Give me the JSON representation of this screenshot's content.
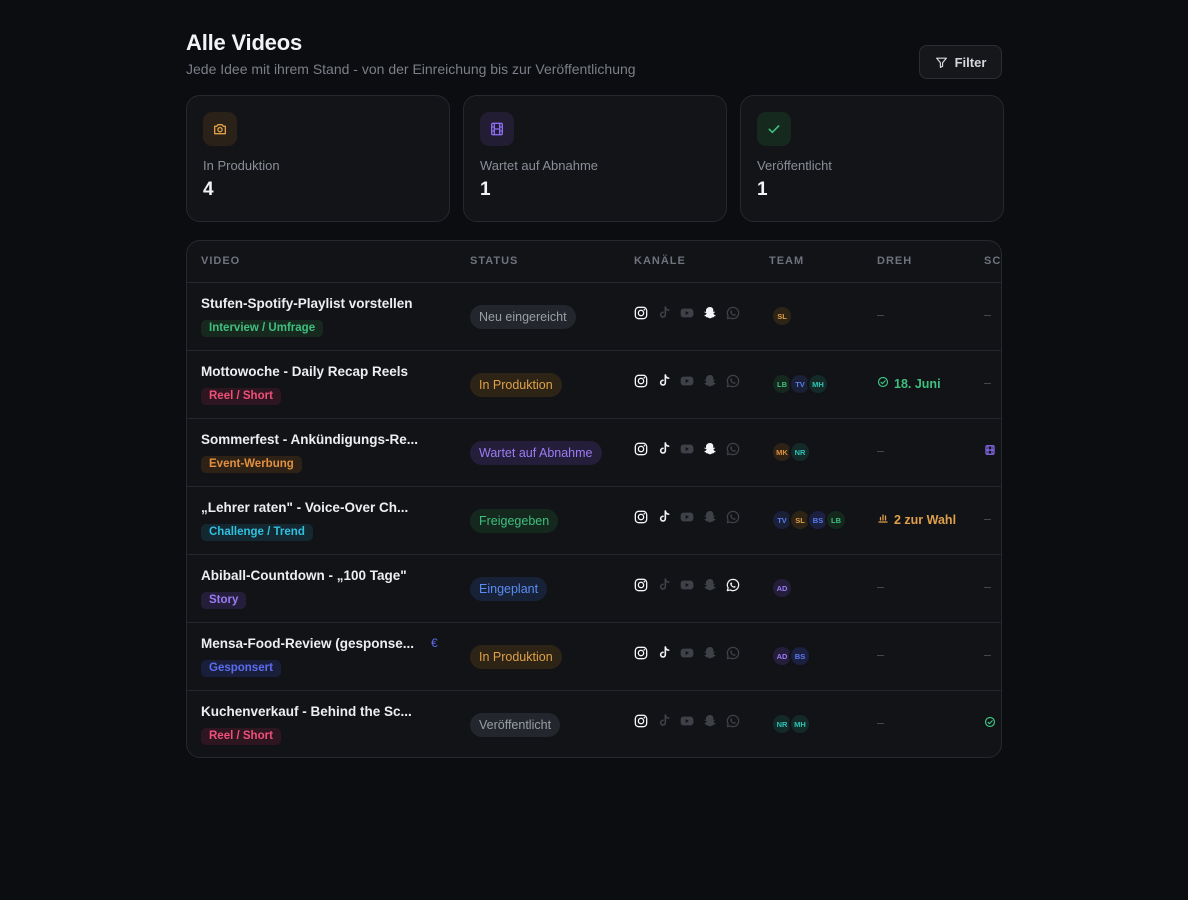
{
  "header": {
    "title": "Alle Videos",
    "subtitle": "Jede Idee mit ihrem Stand - von der Einreichung bis zur Veröffentlichung",
    "filter_label": "Filter"
  },
  "stats": [
    {
      "label": "In Produktion",
      "value": "4",
      "icon": "camera-icon",
      "color": "#e0a04a",
      "bg": "#2a2118"
    },
    {
      "label": "Wartet auf Abnahme",
      "value": "1",
      "icon": "film-icon",
      "color": "#8b6cf0",
      "bg": "#221d33"
    },
    {
      "label": "Veröffentlicht",
      "value": "1",
      "icon": "check-icon",
      "color": "#3fbf7f",
      "bg": "#16291f"
    }
  ],
  "table": {
    "columns": [
      "VIDEO",
      "STATUS",
      "KANÄLE",
      "TEAM",
      "DREH",
      "SC"
    ],
    "rows": [
      {
        "title": "Stufen-Spotify-Playlist vorstellen",
        "tag": "Interview / Umfrage",
        "tag_color": "#3fbf7f",
        "tag_bg": "#17291f",
        "status": "Neu eingereicht",
        "status_color": "#9a9ea6",
        "status_bg": "#23262c",
        "channels": {
          "instagram": true,
          "tiktok": false,
          "youtube": false,
          "snapchat": true,
          "whatsapp": false
        },
        "team": [
          {
            "i": "SL",
            "c": "#e0a04a",
            "b": "#2e2416"
          }
        ],
        "dreh": "–",
        "dreh_type": "none",
        "sc": "–",
        "sc_type": "none"
      },
      {
        "title": "Mottowoche - Daily Recap Reels",
        "tag": "Reel / Short",
        "tag_color": "#f0507a",
        "tag_bg": "#2e1620",
        "status": "In Produktion",
        "status_color": "#e0a04a",
        "status_bg": "#2e2416",
        "channels": {
          "instagram": true,
          "tiktok": true,
          "youtube": false,
          "snapchat": false,
          "whatsapp": false
        },
        "team": [
          {
            "i": "LB",
            "c": "#3fbf7f",
            "b": "#15281e"
          },
          {
            "i": "TV",
            "c": "#5b7cf0",
            "b": "#1a2038"
          },
          {
            "i": "MH",
            "c": "#2fc4b4",
            "b": "#142a28"
          }
        ],
        "dreh": "18. Juni",
        "dreh_type": "date",
        "sc": "–",
        "sc_type": "none"
      },
      {
        "title": "Sommerfest - Ankündigungs-Re...",
        "tag": "Event-Werbung",
        "tag_color": "#e09040",
        "tag_bg": "#2e2216",
        "status": "Wartet auf Abnahme",
        "status_color": "#9b7cf4",
        "status_bg": "#251e3a",
        "channels": {
          "instagram": true,
          "tiktok": true,
          "youtube": false,
          "snapchat": true,
          "whatsapp": false
        },
        "team": [
          {
            "i": "MK",
            "c": "#e09040",
            "b": "#2e2216"
          },
          {
            "i": "NR",
            "c": "#2fc4b4",
            "b": "#142a28"
          }
        ],
        "dreh": "–",
        "dreh_type": "none",
        "sc": "",
        "sc_type": "film"
      },
      {
        "title": "„Lehrer raten\" - Voice-Over Ch...",
        "tag": "Challenge / Trend",
        "tag_color": "#30c0e0",
        "tag_bg": "#132830",
        "status": "Freigegeben",
        "status_color": "#3fbf7f",
        "status_bg": "#15281e",
        "channels": {
          "instagram": true,
          "tiktok": true,
          "youtube": false,
          "snapchat": false,
          "whatsapp": false
        },
        "team": [
          {
            "i": "TV",
            "c": "#5b7cf0",
            "b": "#1a2038"
          },
          {
            "i": "SL",
            "c": "#e0a04a",
            "b": "#2e2416"
          },
          {
            "i": "BS",
            "c": "#5b7cf0",
            "b": "#1c2040"
          },
          {
            "i": "LB",
            "c": "#3fbf7f",
            "b": "#15281e"
          }
        ],
        "dreh": "2 zur Wahl",
        "dreh_type": "vote",
        "sc": "–",
        "sc_type": "none"
      },
      {
        "title": "Abiball-Countdown - „100 Tage\"",
        "tag": "Story",
        "tag_color": "#9b7cf4",
        "tag_bg": "#251e3a",
        "status": "Eingeplant",
        "status_color": "#5b8cf0",
        "status_bg": "#172238",
        "channels": {
          "instagram": true,
          "tiktok": false,
          "youtube": false,
          "snapchat": false,
          "whatsapp": true
        },
        "team": [
          {
            "i": "AD",
            "c": "#9b7cf4",
            "b": "#251e3a"
          }
        ],
        "dreh": "–",
        "dreh_type": "none",
        "sc": "–",
        "sc_type": "none"
      },
      {
        "title": "Mensa-Food-Review (gesponse...",
        "tag": "Gesponsert",
        "tag_color": "#5b6cf0",
        "tag_bg": "#191f3a",
        "sponsored": "€",
        "status": "In Produktion",
        "status_color": "#e0a04a",
        "status_bg": "#2e2416",
        "channels": {
          "instagram": true,
          "tiktok": true,
          "youtube": false,
          "snapchat": false,
          "whatsapp": false
        },
        "team": [
          {
            "i": "AD",
            "c": "#9b7cf4",
            "b": "#251e3a"
          },
          {
            "i": "BS",
            "c": "#5b7cf0",
            "b": "#1c2040"
          }
        ],
        "dreh": "–",
        "dreh_type": "none",
        "sc": "–",
        "sc_type": "none"
      },
      {
        "title": "Kuchenverkauf - Behind the Sc...",
        "tag": "Reel / Short",
        "tag_color": "#f0507a",
        "tag_bg": "#2e1620",
        "status": "Veröffentlicht",
        "status_color": "#9a9ea6",
        "status_bg": "#23262c",
        "channels": {
          "instagram": true,
          "tiktok": false,
          "youtube": false,
          "snapchat": false,
          "whatsapp": false
        },
        "team": [
          {
            "i": "NR",
            "c": "#2fc4b4",
            "b": "#142a28"
          },
          {
            "i": "MH",
            "c": "#2fc4b4",
            "b": "#142a28"
          }
        ],
        "dreh": "–",
        "dreh_type": "none",
        "sc": "",
        "sc_type": "check"
      }
    ]
  }
}
